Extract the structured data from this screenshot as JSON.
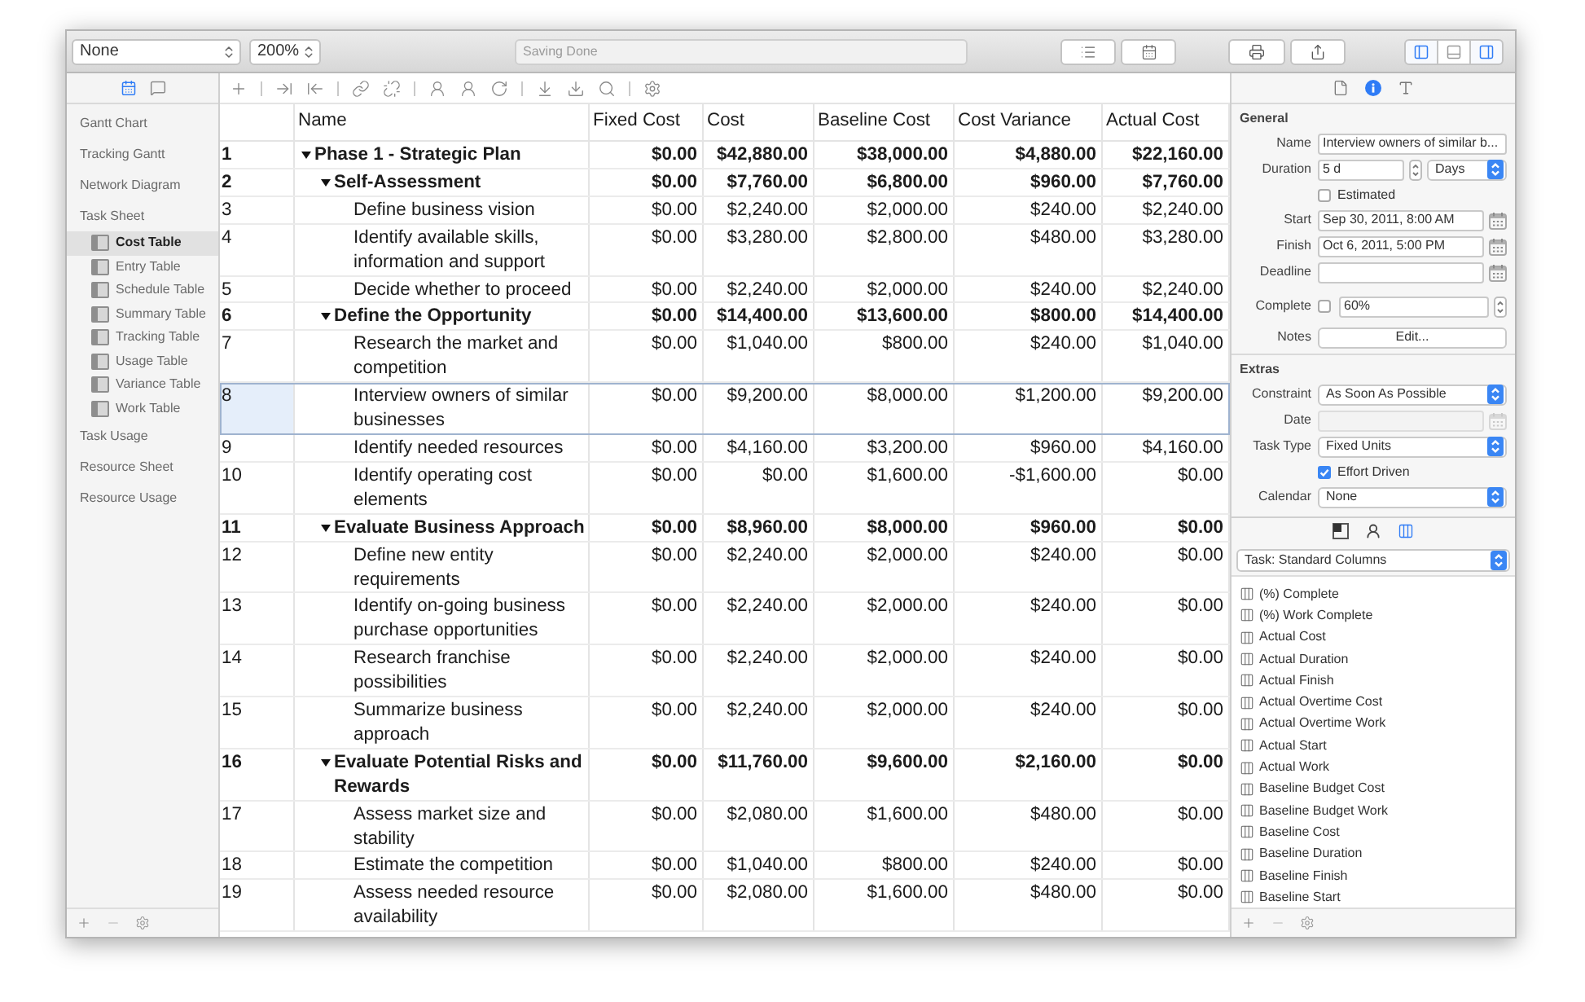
{
  "toolbar": {
    "filter_popup": "None",
    "zoom_popup": "200%",
    "status": "Saving Done",
    "view_toggles": [
      {
        "kind": "left_panel",
        "selected": true
      },
      {
        "kind": "bottom_panel",
        "selected": false
      },
      {
        "kind": "right_panel",
        "selected": true
      }
    ]
  },
  "sidebar": {
    "tabs": [
      {
        "kind": "calendar",
        "selected": true
      },
      {
        "kind": "notes",
        "selected": false
      }
    ],
    "items": [
      {
        "label": "Gantt Chart",
        "selected": false
      },
      {
        "label": "Tracking Gantt",
        "selected": false
      },
      {
        "label": "Network Diagram",
        "selected": false
      },
      {
        "label": "Task Sheet",
        "selected": false,
        "children": [
          {
            "label": "Cost Table",
            "selected": true
          },
          {
            "label": "Entry Table",
            "selected": false
          },
          {
            "label": "Schedule Table",
            "selected": false
          },
          {
            "label": "Summary Table",
            "selected": false
          },
          {
            "label": "Tracking Table",
            "selected": false
          },
          {
            "label": "Usage Table",
            "selected": false
          },
          {
            "label": "Variance Table",
            "selected": false
          },
          {
            "label": "Work Table",
            "selected": false
          }
        ]
      },
      {
        "label": "Task Usage",
        "selected": false
      },
      {
        "label": "Resource Sheet",
        "selected": false
      },
      {
        "label": "Resource Usage",
        "selected": false
      }
    ]
  },
  "table": {
    "columns": [
      "Name",
      "Fixed Cost",
      "Cost",
      "Baseline Cost",
      "Cost Variance",
      "Actual Cost"
    ],
    "rows": [
      {
        "id": "1",
        "name": "Phase 1 - Strategic Plan",
        "expanded": true,
        "selected": false,
        "values": [
          "$0.00",
          "$42,880.00",
          "$38,000.00",
          "$4,880.00",
          "$22,160.00"
        ],
        "children": [
          {
            "id": "2",
            "name": "Self-Assessment",
            "expanded": true,
            "selected": false,
            "values": [
              "$0.00",
              "$7,760.00",
              "$6,800.00",
              "$960.00",
              "$7,760.00"
            ],
            "children": [
              {
                "id": "3",
                "name": "Define business vision",
                "selected": false,
                "values": [
                  "$0.00",
                  "$2,240.00",
                  "$2,000.00",
                  "$240.00",
                  "$2,240.00"
                ]
              },
              {
                "id": "4",
                "name": "Identify available skills, information and support",
                "selected": false,
                "values": [
                  "$0.00",
                  "$3,280.00",
                  "$2,800.00",
                  "$480.00",
                  "$3,280.00"
                ]
              },
              {
                "id": "5",
                "name": "Decide whether to proceed",
                "selected": false,
                "values": [
                  "$0.00",
                  "$2,240.00",
                  "$2,000.00",
                  "$240.00",
                  "$2,240.00"
                ]
              }
            ]
          },
          {
            "id": "6",
            "name": "Define the Opportunity",
            "expanded": true,
            "selected": false,
            "values": [
              "$0.00",
              "$14,400.00",
              "$13,600.00",
              "$800.00",
              "$14,400.00"
            ],
            "children": [
              {
                "id": "7",
                "name": "Research the market and competition",
                "selected": false,
                "values": [
                  "$0.00",
                  "$1,040.00",
                  "$800.00",
                  "$240.00",
                  "$1,040.00"
                ]
              },
              {
                "id": "8",
                "name": "Interview owners of similar businesses",
                "selected": true,
                "values": [
                  "$0.00",
                  "$9,200.00",
                  "$8,000.00",
                  "$1,200.00",
                  "$9,200.00"
                ]
              },
              {
                "id": "9",
                "name": "Identify needed resources",
                "selected": false,
                "values": [
                  "$0.00",
                  "$4,160.00",
                  "$3,200.00",
                  "$960.00",
                  "$4,160.00"
                ]
              },
              {
                "id": "10",
                "name": "Identify operating cost elements",
                "selected": false,
                "values": [
                  "$0.00",
                  "$0.00",
                  "$1,600.00",
                  "-$1,600.00",
                  "$0.00"
                ]
              }
            ]
          },
          {
            "id": "11",
            "name": "Evaluate Business Approach",
            "expanded": true,
            "selected": false,
            "values": [
              "$0.00",
              "$8,960.00",
              "$8,000.00",
              "$960.00",
              "$0.00"
            ],
            "children": [
              {
                "id": "12",
                "name": "Define new entity requirements",
                "selected": false,
                "values": [
                  "$0.00",
                  "$2,240.00",
                  "$2,000.00",
                  "$240.00",
                  "$0.00"
                ]
              },
              {
                "id": "13",
                "name": "Identify on-going business purchase opportunities",
                "selected": false,
                "values": [
                  "$0.00",
                  "$2,240.00",
                  "$2,000.00",
                  "$240.00",
                  "$0.00"
                ]
              },
              {
                "id": "14",
                "name": "Research franchise possibilities",
                "selected": false,
                "values": [
                  "$0.00",
                  "$2,240.00",
                  "$2,000.00",
                  "$240.00",
                  "$0.00"
                ]
              },
              {
                "id": "15",
                "name": "Summarize business approach",
                "selected": false,
                "values": [
                  "$0.00",
                  "$2,240.00",
                  "$2,000.00",
                  "$240.00",
                  "$0.00"
                ]
              }
            ]
          },
          {
            "id": "16",
            "name": "Evaluate Potential Risks and Rewards",
            "expanded": true,
            "selected": false,
            "values": [
              "$0.00",
              "$11,760.00",
              "$9,600.00",
              "$2,160.00",
              "$0.00"
            ],
            "children": [
              {
                "id": "17",
                "name": "Assess market size and stability",
                "selected": false,
                "values": [
                  "$0.00",
                  "$2,080.00",
                  "$1,600.00",
                  "$480.00",
                  "$0.00"
                ]
              },
              {
                "id": "18",
                "name": "Estimate the competition",
                "selected": false,
                "values": [
                  "$0.00",
                  "$1,040.00",
                  "$800.00",
                  "$240.00",
                  "$0.00"
                ]
              },
              {
                "id": "19",
                "name": "Assess needed resource availability",
                "selected": false,
                "values": [
                  "$0.00",
                  "$2,080.00",
                  "$1,600.00",
                  "$480.00",
                  "$0.00"
                ]
              }
            ]
          }
        ]
      }
    ]
  },
  "inspector": {
    "tabs": [
      {
        "kind": "document",
        "selected": false
      },
      {
        "kind": "info",
        "selected": true
      },
      {
        "kind": "format",
        "selected": false
      }
    ],
    "sections": [
      {
        "title": "General",
        "fields": [
          {
            "kind": "text",
            "label": "Name",
            "value": "Interview owners of similar b...",
            "disabled": false
          },
          {
            "kind": "duration",
            "label": "Duration",
            "value": "5 d",
            "unit": "Days",
            "disabled": false
          },
          {
            "kind": "checkbox",
            "label": "Estimated",
            "checked": false,
            "disabled": false
          },
          {
            "kind": "date",
            "label": "Start",
            "value": "Sep 30, 2011, 8:00 AM",
            "disabled": false
          },
          {
            "kind": "date",
            "label": "Finish",
            "value": "Oct 6, 2011, 5:00 PM",
            "disabled": false
          },
          {
            "kind": "date",
            "label": "Deadline",
            "disabled": false
          },
          {
            "kind": "percent",
            "label": "Complete",
            "checked": false,
            "value": "60%",
            "disabled": false
          },
          {
            "kind": "button",
            "label": "Notes",
            "value": "Edit...",
            "disabled": false
          }
        ]
      },
      {
        "title": "Extras",
        "fields": [
          {
            "kind": "popup",
            "label": "Constraint",
            "value": "As Soon As Possible",
            "disabled": false
          },
          {
            "kind": "date",
            "label": "Date",
            "disabled": true
          },
          {
            "kind": "popup",
            "label": "Task Type",
            "value": "Fixed Units",
            "disabled": false
          },
          {
            "kind": "checkbox",
            "label": "Effort Driven",
            "checked": true,
            "disabled": false
          },
          {
            "kind": "popup",
            "label": "Calendar",
            "value": "None",
            "disabled": false
          }
        ]
      }
    ]
  },
  "columns_panel": {
    "tabs": [
      {
        "kind": "layout",
        "selected": false
      },
      {
        "kind": "person",
        "selected": false
      },
      {
        "kind": "columns",
        "selected": true
      }
    ],
    "column_set": "Task: Standard Columns",
    "columns": [
      "(%) Complete",
      "(%) Work Complete",
      "Actual Cost",
      "Actual Duration",
      "Actual Finish",
      "Actual Overtime Cost",
      "Actual Overtime Work",
      "Actual Start",
      "Actual Work",
      "Baseline Budget Cost",
      "Baseline Budget Work",
      "Baseline Cost",
      "Baseline Duration",
      "Baseline Finish",
      "Baseline Start"
    ]
  }
}
